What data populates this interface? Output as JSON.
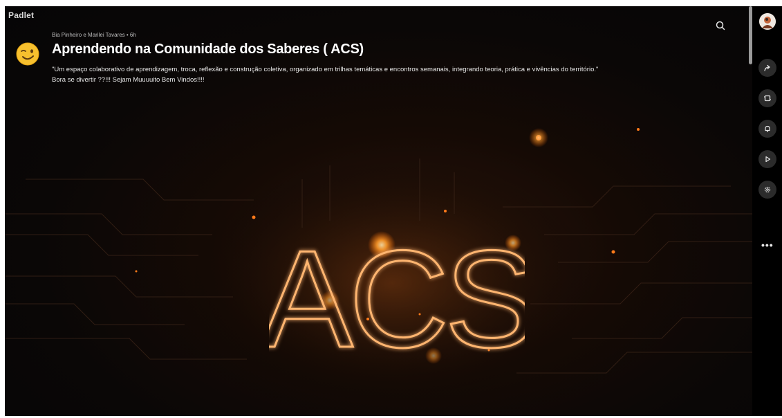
{
  "app": {
    "brand": "Padlet"
  },
  "header": {
    "author_line": "Bia Pinheiro e Marilei Tavares • 6h",
    "title": "Aprendendo na Comunidade dos Saberes ( ACS)",
    "description": "\"Um espaço colaborativo de aprendizagem, troca, reflexão e construção coletiva, organizado em trilhas temáticas e encontros semanais, integrando teoria, prática e vivências do território.\"",
    "tagline": "Bora se divertir ??!!! Sejam Muuuuito Bem Vindos!!!!"
  },
  "hero": {
    "wordmark": "ACS"
  },
  "toolbar": {
    "search_icon": "search-icon",
    "rail_items": [
      {
        "icon": "user-avatar"
      },
      {
        "icon": "share-icon"
      },
      {
        "icon": "remake-icon"
      },
      {
        "icon": "bell-icon"
      },
      {
        "icon": "slideshow-icon"
      },
      {
        "icon": "settings-icon"
      },
      {
        "icon": "more-icon",
        "label": "•••"
      }
    ]
  },
  "colors": {
    "background": "#0a0706",
    "accent_glow": "#ff8a1f",
    "title_text": "#ffffff",
    "rail_button": "#2b2b2b"
  }
}
